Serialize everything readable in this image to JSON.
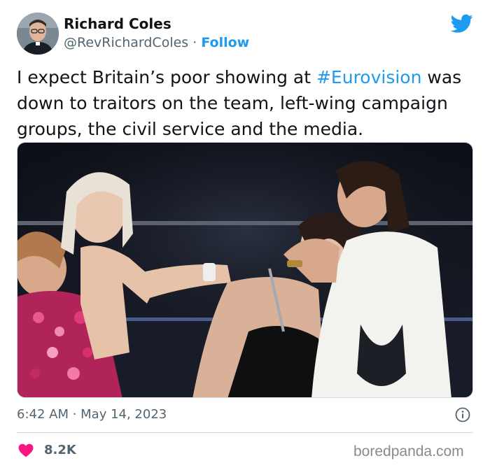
{
  "tweet": {
    "author_name": "Richard Coles",
    "handle": "@RevRichardColes",
    "separator": "·",
    "follow_label": "Follow",
    "text_before": "I expect Britain’s poor showing at ",
    "hashtag": "#Eurovision",
    "text_after": " was down to traitors on the team, left-wing campaign groups, the civil service and the media.",
    "timestamp": "6:42 AM · May 14, 2023",
    "likes": "8.2K"
  },
  "watermark": "boredpanda.com",
  "colors": {
    "accent": "#1d9bf0",
    "heart": "#f91880",
    "secondary_text": "#536471"
  },
  "icons": [
    "twitter-bird-icon",
    "info-icon",
    "heart-icon"
  ]
}
